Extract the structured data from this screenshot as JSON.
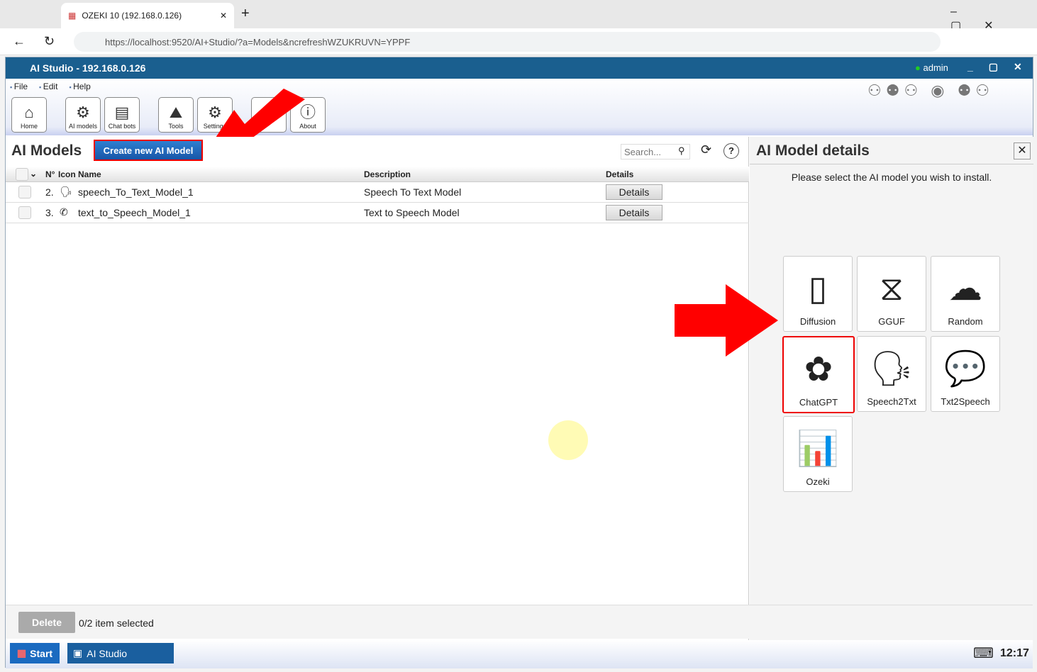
{
  "browser": {
    "tab_title": "OZEKI 10 (192.168.0.126)",
    "url": "https://localhost:9520/AI+Studio/?a=Models&ncrefreshWZUKRUVN=YPPF"
  },
  "app": {
    "title": "AI Studio - 192.168.0.126",
    "user": "admin",
    "menu": [
      "File",
      "Edit",
      "Help"
    ],
    "toolbar": [
      {
        "label": "Home",
        "icon": "⌂"
      },
      {
        "label": "AI models",
        "icon": "⚙"
      },
      {
        "label": "Chat bots",
        "icon": "▤"
      },
      {
        "label": "Tools",
        "icon": "⛰"
      },
      {
        "label": "Settings",
        "icon": "⚙"
      },
      {
        "label": "",
        "icon": ""
      },
      {
        "label": "About",
        "icon": "ⓘ"
      }
    ]
  },
  "left": {
    "title": "AI Models",
    "create_label": "Create new AI Model",
    "search_placeholder": "Search...",
    "columns": {
      "num": "N°",
      "icon": "Icon",
      "name": "Name",
      "description": "Description",
      "details": "Details"
    },
    "rows": [
      {
        "num": "2.",
        "icon": "🗣",
        "name": "speech_To_Text_Model_1",
        "description": "Speech To Text Model",
        "details": "Details"
      },
      {
        "num": "3.",
        "icon": "✆",
        "name": "text_to_Speech_Model_1",
        "description": "Text to Speech Model",
        "details": "Details"
      }
    ],
    "delete_label": "Delete",
    "selection_status": "0/2 item selected"
  },
  "right": {
    "title": "AI Model details",
    "prompt": "Please select the AI model you wish to install.",
    "tiles": [
      {
        "label": "Diffusion",
        "icon": "▯"
      },
      {
        "label": "GGUF",
        "icon": "⧖"
      },
      {
        "label": "Random",
        "icon": "☁"
      },
      {
        "label": "ChatGPT",
        "icon": "✿",
        "highlighted": true
      },
      {
        "label": "Speech2Txt",
        "icon": "🗣"
      },
      {
        "label": "Txt2Speech",
        "icon": "💬"
      },
      {
        "label": "Ozeki",
        "icon": "📊"
      }
    ]
  },
  "taskbar": {
    "start": "Start",
    "app": "AI Studio",
    "time": "12:17"
  },
  "colors": {
    "titlebar": "#1a5f8f",
    "accent": "#1756a8",
    "highlight": "#e00000"
  }
}
